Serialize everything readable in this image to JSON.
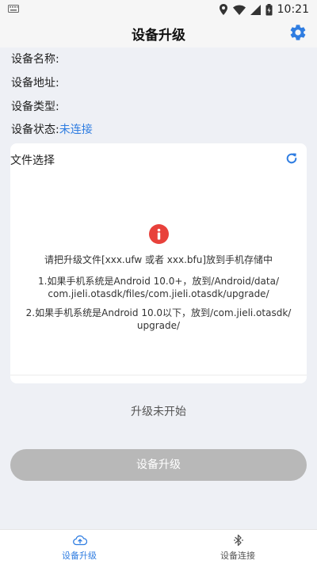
{
  "status_bar": {
    "time": "10:21"
  },
  "app_bar": {
    "title": "设备升级"
  },
  "device_info": {
    "name_label": "设备名称:",
    "address_label": "设备地址:",
    "type_label": "设备类型:",
    "status_label": "设备状态:",
    "status_value": "未连接"
  },
  "file_select": {
    "title": "文件选择",
    "hint_main": "请把升级文件[xxx.ufw 或者 xxx.bfu]放到手机存储中",
    "hint_1_line1": "1.如果手机系统是Android 10.0+，放到/Android/data/",
    "hint_1_line2": "com.jieli.otasdk/files/com.jieli.otasdk/upgrade/",
    "hint_2_line1": "2.如果手机系统是Android 10.0以下，放到/com.jieli.otasdk/",
    "hint_2_line2": "upgrade/"
  },
  "upgrade": {
    "progress_text": "升级未开始",
    "button_label": "设备升级"
  },
  "bottom_nav": {
    "items": [
      {
        "label": "设备升级",
        "icon": "cloud-upload-icon",
        "active": true
      },
      {
        "label": "设备连接",
        "icon": "bluetooth-icon",
        "active": false
      }
    ]
  },
  "colors": {
    "accent": "#2f7de1",
    "alert": "#e8413b",
    "button_disabled": "#b8b8b8",
    "background": "#eef0f5"
  }
}
